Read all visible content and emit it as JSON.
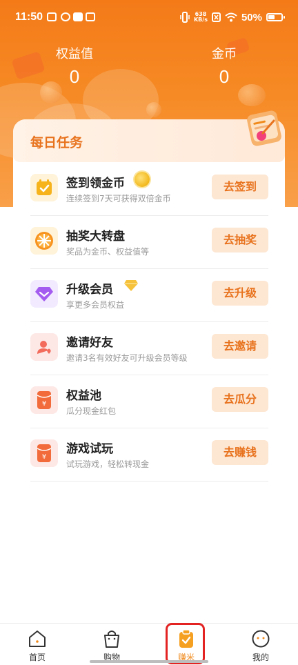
{
  "status_bar": {
    "time": "11:50",
    "net_speed_top": "638",
    "net_speed_bottom": "KB/s",
    "battery": "50%"
  },
  "stats": {
    "points_label": "权益值",
    "points_value": "0",
    "coins_label": "金币",
    "coins_value": "0"
  },
  "card": {
    "title": "每日任务"
  },
  "tasks": [
    {
      "title": "签到领金币",
      "subtitle": "连续签到7天可获得双倍金币",
      "button": "去签到",
      "icon": "calendar-check-icon"
    },
    {
      "title": "抽奖大转盘",
      "subtitle": "奖品为金币、权益值等",
      "button": "去抽奖",
      "icon": "lottery-wheel-icon"
    },
    {
      "title": "升级会员",
      "subtitle": "享更多会员权益",
      "button": "去升级",
      "icon": "diamond-icon"
    },
    {
      "title": "邀请好友",
      "subtitle": "邀请3名有效好友可升级会员等级",
      "button": "去邀请",
      "icon": "invite-friend-icon"
    },
    {
      "title": "权益池",
      "subtitle": "瓜分现金红包",
      "button": "去瓜分",
      "icon": "red-packet-icon"
    },
    {
      "title": "游戏试玩",
      "subtitle": "试玩游戏，轻松转现金",
      "button": "去赚钱",
      "icon": "red-packet-icon"
    }
  ],
  "bottom_nav": [
    {
      "label": "首页",
      "icon": "home-icon"
    },
    {
      "label": "购物",
      "icon": "shopping-bag-icon"
    },
    {
      "label": "赚米",
      "icon": "earn-clipboard-icon",
      "active": true
    },
    {
      "label": "我的",
      "icon": "profile-face-icon"
    }
  ],
  "colors": {
    "accent": "#f47a18",
    "button_bg": "#fde6d2",
    "button_text": "#e8731e",
    "highlight_outline": "#e32222"
  }
}
